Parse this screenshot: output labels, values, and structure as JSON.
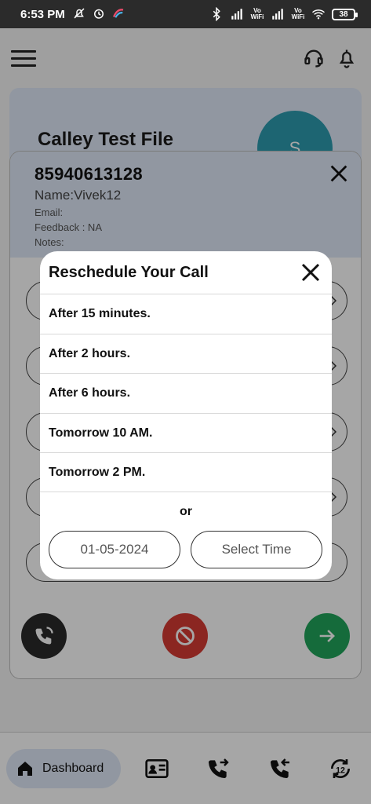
{
  "status_bar": {
    "time": "6:53 PM",
    "battery": "38",
    "vowifi_1": "Vo\nWiFi",
    "vowifi_2": "Vo\nWiFi"
  },
  "header": {
    "menu_icon": "hamburger-icon",
    "support_icon": "headset-icon",
    "notification_icon": "bell-icon"
  },
  "background_card": {
    "title": "Calley Test File",
    "avatar_letter": "S"
  },
  "contact": {
    "phone": "85940613128",
    "name": "Name:Vivek12",
    "email": "Email:",
    "feedback": "Feedback : NA",
    "notes": "Notes:"
  },
  "actions": {
    "reschedule_icon": "phone-reschedule-icon",
    "block_icon": "block-icon",
    "next_icon": "arrow-right-icon"
  },
  "bottom_nav": {
    "dashboard_label": "Dashboard",
    "items": [
      "contact-card-icon",
      "outgoing-call-icon",
      "incoming-call-icon",
      "follow-up-12-icon"
    ]
  },
  "dialog": {
    "title": "Reschedule Your Call",
    "options": [
      "After 15 minutes.",
      "After 2 hours.",
      "After 6 hours.",
      "Tomorrow 10 AM.",
      "Tomorrow 2 PM."
    ],
    "or_label": "or",
    "date_value": "01-05-2024",
    "time_label": "Select Time"
  },
  "colors": {
    "accent_light": "#dfe8f8",
    "avatar": "#2d9bb0",
    "block": "#d63b33",
    "next": "#21a55b"
  }
}
